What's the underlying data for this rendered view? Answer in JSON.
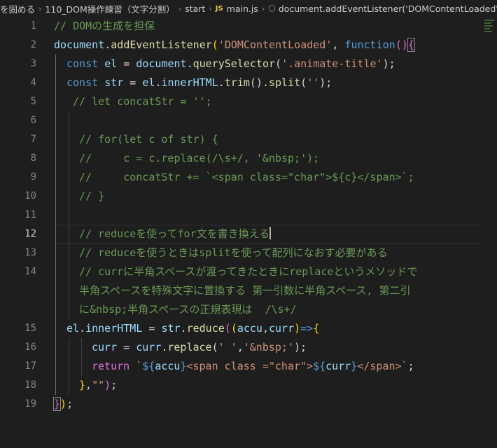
{
  "breadcrumb": {
    "crumb1": "を固める",
    "crumb2": "110_DOM操作練習（文字分割）",
    "crumb3": "start",
    "file_badge": "JS",
    "file": "main.js",
    "symbol": "document.addEventListener('DOMContentLoaded' callback"
  },
  "editor": {
    "current_line": 12,
    "line_numbers": [
      "1",
      "2",
      "3",
      "4",
      "5",
      "6",
      "7",
      "8",
      "9",
      "10",
      "11",
      "12",
      "13",
      "14",
      "15",
      "16",
      "17",
      "18",
      "19"
    ],
    "l1": "// DOMの生成を担保",
    "l2": {
      "a": "document",
      "b": ".",
      "c": "addEventListener",
      "d": "(",
      "e": "'DOMContentLoaded'",
      "f": ", ",
      "g": "function",
      "h": "()",
      "i": "{"
    },
    "l3": {
      "a": "const",
      "b": " ",
      "c": "el",
      "d": " = ",
      "e": "document",
      "f": ".",
      "g": "querySelector",
      "h": "(",
      "i": "'.animate-title'",
      "j": ");"
    },
    "l4": {
      "a": "const",
      "b": " ",
      "c": "str",
      "d": " = ",
      "e": "el",
      "f": ".",
      "g": "innerHTML",
      "h": ".",
      "i": "trim",
      "j": "().",
      "k": "split",
      "l": "(",
      "m": "''",
      "n": ");"
    },
    "l5": "// let concatStr = '';",
    "l7": "// for(let c of str) {",
    "l8": "//     c = c.replace(/\\s+/, '&nbsp;');",
    "l9": "//     concatStr += `<span class=\"char\">${c}</span>`;",
    "l10": "// }",
    "l12": "// reduceを使ってfor文を書き換える",
    "l13": "// reduceを使うときはsplitを使って配列になおす必要がある",
    "l14a": "// currに半角スペースが渡ってきたときにreplaceというメソッドで",
    "l14b": "半角スペースを特殊文字に置換する 第一引数に半角スペース, 第二引",
    "l14c": "に&nbsp;半角スペースの正規表現は  /\\s+/",
    "l15": {
      "a": "el",
      "b": ".",
      "c": "innerHTML",
      "d": " = ",
      "e": "str",
      "f": ".",
      "g": "reduce",
      "h": "(",
      "i": "(",
      "j": "accu",
      "k": ",",
      "l": "curr",
      "m": ")",
      "n": "=>",
      "o": "{"
    },
    "l16": {
      "a": "curr",
      "b": " = ",
      "c": "curr",
      "d": ".",
      "e": "replace",
      "f": "(",
      "g": "' '",
      "h": ",",
      "i": "'&nbsp;'",
      "j": ");"
    },
    "l17": {
      "a": "return",
      "b": " ",
      "c": "`",
      "d": "${",
      "e": "accu",
      "f": "}",
      "g": "<span class =\"char\">",
      "h": "${",
      "i": "curr",
      "j": "}",
      "k": "</span>",
      "l": "`",
      "m": ";"
    },
    "l18": {
      "a": "}",
      "b": ",",
      "c": "\"\"",
      "d": ")",
      "e": ";"
    },
    "l19": {
      "a": "}",
      "b": ")",
      "c": ";"
    }
  },
  "colors": {
    "background": "#1e1e1e",
    "comment": "#6a9955",
    "keyword": "#569cd6",
    "variable": "#9cdcfe",
    "function": "#dcdcaa",
    "string": "#ce9178",
    "bracket_level1": "#ffd700",
    "bracket_level2": "#da70d6"
  }
}
